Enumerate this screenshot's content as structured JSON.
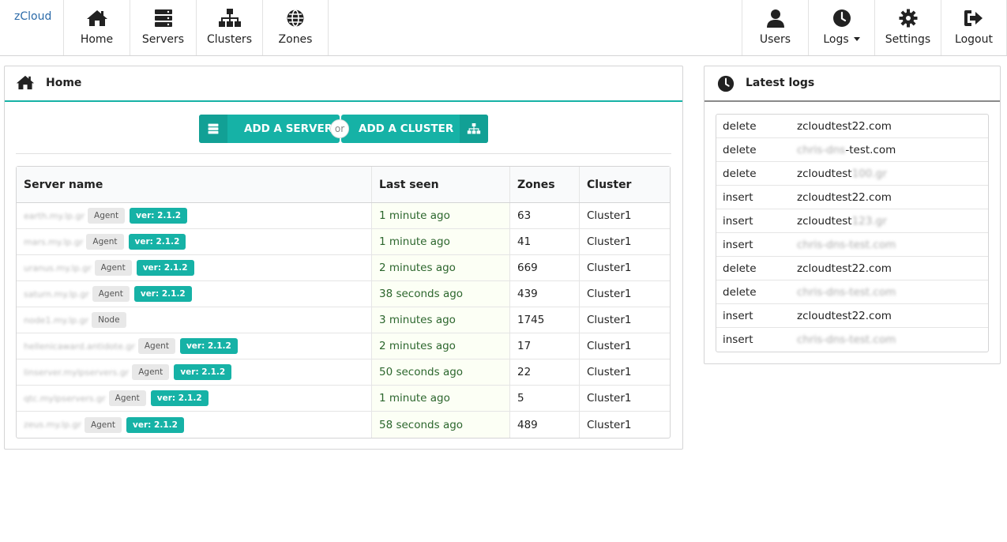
{
  "nav": {
    "brand": "zCloud",
    "left_items": [
      {
        "label": "Home",
        "icon": "home-icon"
      },
      {
        "label": "Servers",
        "icon": "server-icon"
      },
      {
        "label": "Clusters",
        "icon": "sitemap-icon"
      },
      {
        "label": "Zones",
        "icon": "globe-icon"
      }
    ],
    "right_items": [
      {
        "label": "Users",
        "icon": "user-icon"
      },
      {
        "label": "Logs",
        "icon": "clock-icon",
        "dropdown": true
      },
      {
        "label": "Settings",
        "icon": "gear-icon"
      },
      {
        "label": "Logout",
        "icon": "sign-out-icon"
      }
    ]
  },
  "home_panel": {
    "title": "Home",
    "add_server_label": "ADD A SERVER",
    "or_label": "or",
    "add_cluster_label": "ADD A CLUSTER",
    "table": {
      "headers": [
        "Server name",
        "Last seen",
        "Zones",
        "Cluster"
      ],
      "rows": [
        {
          "name": "earth.my.lp.gr",
          "type": "Agent",
          "version": "ver: 2.1.2",
          "last_seen": "1 minute ago",
          "zones": "63",
          "cluster": "Cluster1"
        },
        {
          "name": "mars.my.lp.gr",
          "type": "Agent",
          "version": "ver: 2.1.2",
          "last_seen": "1 minute ago",
          "zones": "41",
          "cluster": "Cluster1"
        },
        {
          "name": "uranus.my.lp.gr",
          "type": "Agent",
          "version": "ver: 2.1.2",
          "last_seen": "2 minutes ago",
          "zones": "669",
          "cluster": "Cluster1"
        },
        {
          "name": "saturn.my.lp.gr",
          "type": "Agent",
          "version": "ver: 2.1.2",
          "last_seen": "38 seconds ago",
          "zones": "439",
          "cluster": "Cluster1"
        },
        {
          "name": "node1.my.lp.gr",
          "type": "Node",
          "version": "",
          "last_seen": "3 minutes ago",
          "zones": "1745",
          "cluster": "Cluster1"
        },
        {
          "name": "hellenicaward.antidote.gr",
          "type": "Agent",
          "version": "ver: 2.1.2",
          "last_seen": "2 minutes ago",
          "zones": "17",
          "cluster": "Cluster1"
        },
        {
          "name": "linserver.mylpservers.gr",
          "type": "Agent",
          "version": "ver: 2.1.2",
          "last_seen": "50 seconds ago",
          "zones": "22",
          "cluster": "Cluster1"
        },
        {
          "name": "qtc.mylpservers.gr",
          "type": "Agent",
          "version": "ver: 2.1.2",
          "last_seen": "1 minute ago",
          "zones": "5",
          "cluster": "Cluster1"
        },
        {
          "name": "zeus.my.lp.gr",
          "type": "Agent",
          "version": "ver: 2.1.2",
          "last_seen": "58 seconds ago",
          "zones": "489",
          "cluster": "Cluster1"
        }
      ]
    }
  },
  "logs_panel": {
    "title": "Latest logs",
    "rows": [
      {
        "action": "delete",
        "domain": "zcloudtest22.com",
        "blur": false
      },
      {
        "action": "delete",
        "domain": "chris-dns-test.com",
        "blur": "partial"
      },
      {
        "action": "delete",
        "domain": "zcloudtest",
        "suffix": "100.gr",
        "blur": "suffix"
      },
      {
        "action": "insert",
        "domain": "zcloudtest22.com",
        "blur": false
      },
      {
        "action": "insert",
        "domain": "zcloudtest",
        "suffix": "123.gr",
        "blur": "suffix"
      },
      {
        "action": "insert",
        "domain": "chris-dns-test.com",
        "blur": true
      },
      {
        "action": "delete",
        "domain": "zcloudtest22.com",
        "blur": false
      },
      {
        "action": "delete",
        "domain": "chris-dns-test.com",
        "blur": true
      },
      {
        "action": "insert",
        "domain": "zcloudtest22.com",
        "blur": false
      },
      {
        "action": "insert",
        "domain": "chris-dns-test.com",
        "blur": true
      }
    ]
  },
  "colors": {
    "accent": "#16b2a6",
    "accent_dark": "#12a095",
    "positive_text": "#2c662d",
    "brand": "#2b6aa8"
  }
}
